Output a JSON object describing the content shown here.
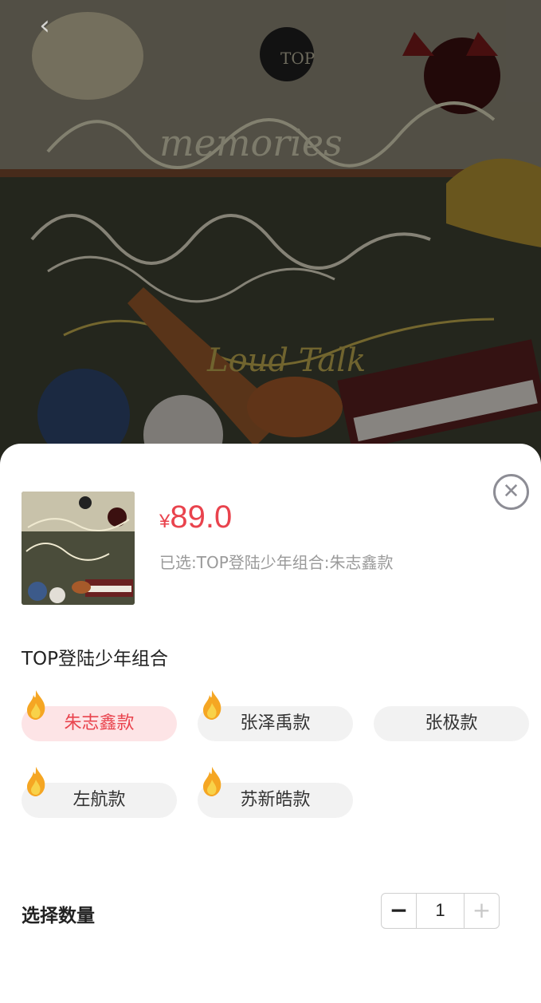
{
  "nav": {
    "back_glyph": "‹"
  },
  "cover_art": {
    "logo_text": "TOP",
    "title_en": "memories",
    "script_text": "Loud Talk"
  },
  "product": {
    "currency": "¥",
    "price": "89.0",
    "selected_text": "已选:TOP登陆少年组合:朱志鑫款",
    "close_glyph": "✕"
  },
  "option_group": {
    "title": "TOP登陆少年组合",
    "options": [
      {
        "label": "朱志鑫款",
        "hot": true,
        "selected": true
      },
      {
        "label": "张泽禹款",
        "hot": true,
        "selected": false
      },
      {
        "label": "张极款",
        "hot": false,
        "selected": false
      },
      {
        "label": "左航款",
        "hot": true,
        "selected": false
      },
      {
        "label": "苏新皓款",
        "hot": true,
        "selected": false
      }
    ]
  },
  "quantity": {
    "label": "选择数量",
    "value": "1",
    "minus": "−",
    "plus": "+"
  },
  "colors": {
    "accent": "#e9434d",
    "selected_bg": "#fde4e6",
    "option_bg": "#f2f2f2"
  }
}
